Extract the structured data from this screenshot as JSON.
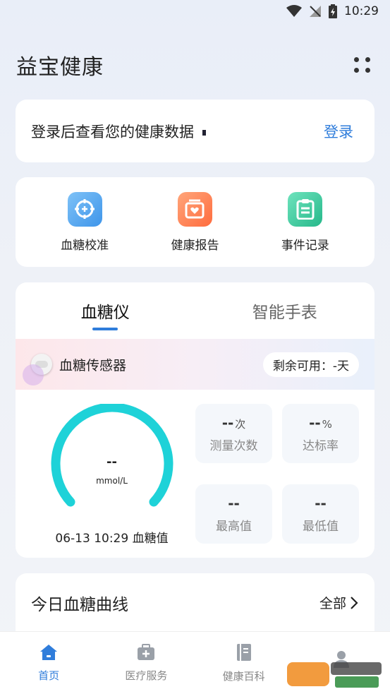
{
  "status_bar": {
    "time": "10:29"
  },
  "header": {
    "title": "益宝健康"
  },
  "login_card": {
    "prompt": "登录后查看您的健康数据",
    "action": "登录"
  },
  "quick_actions": [
    {
      "label": "血糖校准",
      "icon": "calibration-icon"
    },
    {
      "label": "健康报告",
      "icon": "report-icon"
    },
    {
      "label": "事件记录",
      "icon": "clipboard-icon"
    }
  ],
  "device_tabs": [
    {
      "label": "血糖仪",
      "active": true
    },
    {
      "label": "智能手表",
      "active": false
    }
  ],
  "sensor": {
    "name": "血糖传感器",
    "remaining": "剩余可用：-天"
  },
  "gauge": {
    "value": "--",
    "unit": "mmol/L",
    "caption": "06-13 10:29 血糖值"
  },
  "stats": [
    {
      "value": "--",
      "unit": "次",
      "label": "测量次数"
    },
    {
      "value": "--",
      "unit": "%",
      "label": "达标率"
    },
    {
      "value": "--",
      "unit": "",
      "label": "最高值"
    },
    {
      "value": "--",
      "unit": "",
      "label": "最低值"
    }
  ],
  "curve": {
    "title": "今日血糖曲线",
    "all": "全部"
  },
  "bottom_nav": [
    {
      "label": "首页",
      "active": true
    },
    {
      "label": "医疗服务",
      "active": false
    },
    {
      "label": "健康百科",
      "active": false
    }
  ],
  "colors": {
    "accent": "#2f7ddb",
    "gauge": "#1ed2d8"
  }
}
